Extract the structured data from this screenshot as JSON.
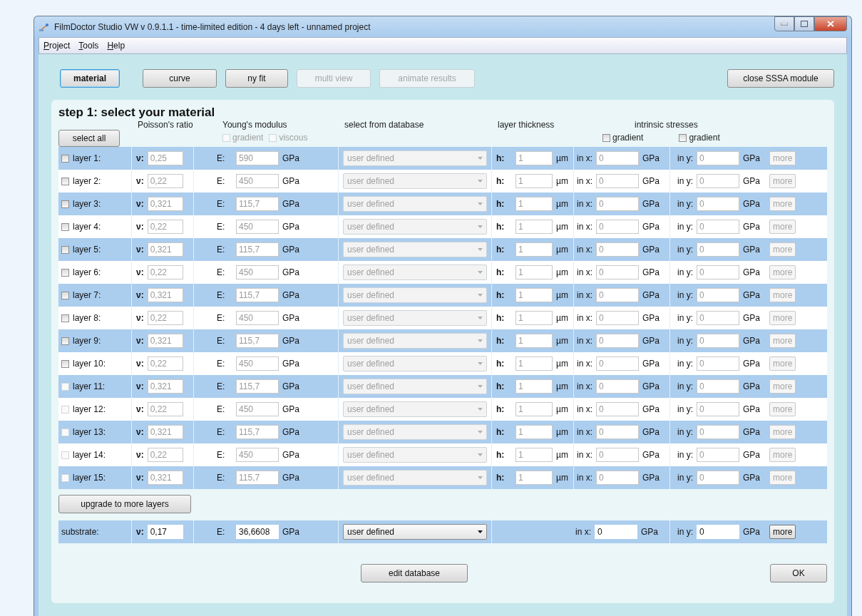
{
  "window": {
    "title": "FilmDoctor Studio VW v 0.9.1.1 - time-limited edition - 4 days left - unnamed project"
  },
  "menu": [
    {
      "label": "Project"
    },
    {
      "label": "Tools"
    },
    {
      "label": "Help"
    }
  ],
  "toolbar": [
    {
      "label": "material",
      "selected": true,
      "disabled": false
    },
    {
      "label": "curve",
      "selected": false,
      "disabled": false
    },
    {
      "label": "ny fit",
      "selected": false,
      "disabled": false
    },
    {
      "label": "multi view",
      "selected": false,
      "disabled": true
    },
    {
      "label": "animate results",
      "selected": false,
      "disabled": true
    }
  ],
  "close_button": "close SSSA module",
  "step_title": "step 1: select your material",
  "select_all": "select all",
  "headers": {
    "poisson": "Poisson's ratio",
    "young": "Young's modulus",
    "database": "select from database",
    "thickness": "layer thickness",
    "stresses": "intrinsic stresses"
  },
  "young_options": [
    {
      "label": "gradient",
      "checked": false,
      "disabled": true
    },
    {
      "label": "viscous",
      "checked": false,
      "disabled": true
    }
  ],
  "stress_options": [
    {
      "label": "gradient",
      "checked": false,
      "disabled": false
    },
    {
      "label": "gradient",
      "checked": false,
      "disabled": false
    }
  ],
  "layers": [
    {
      "label": "layer 1:",
      "checked": false,
      "checkbox_disabled": false,
      "disabled": true,
      "nu_label": "ν:",
      "nu": "0,25",
      "e_label": "E:",
      "e": "590",
      "e_unit": "GPa",
      "database": "user defined",
      "h_label": "h:",
      "h": "1",
      "h_unit": "µm",
      "sx_label": "in x:",
      "sx": "0",
      "sx_unit": "GPa",
      "sy_label": "in y:",
      "sy": "0",
      "sy_unit": "GPa",
      "more": "more"
    },
    {
      "label": "layer 2:",
      "checked": false,
      "checkbox_disabled": false,
      "disabled": true,
      "nu_label": "ν:",
      "nu": "0,22",
      "e_label": "E:",
      "e": "450",
      "e_unit": "GPa",
      "database": "user defined",
      "h_label": "h:",
      "h": "1",
      "h_unit": "µm",
      "sx_label": "in x:",
      "sx": "0",
      "sx_unit": "GPa",
      "sy_label": "in y:",
      "sy": "0",
      "sy_unit": "GPa",
      "more": "more"
    },
    {
      "label": "layer 3:",
      "checked": false,
      "checkbox_disabled": false,
      "disabled": true,
      "nu_label": "ν:",
      "nu": "0,321",
      "e_label": "E:",
      "e": "115,7",
      "e_unit": "GPa",
      "database": "user defined",
      "h_label": "h:",
      "h": "1",
      "h_unit": "µm",
      "sx_label": "in x:",
      "sx": "0",
      "sx_unit": "GPa",
      "sy_label": "in y:",
      "sy": "0",
      "sy_unit": "GPa",
      "more": "more"
    },
    {
      "label": "layer 4:",
      "checked": false,
      "checkbox_disabled": false,
      "disabled": true,
      "nu_label": "ν:",
      "nu": "0,22",
      "e_label": "E:",
      "e": "450",
      "e_unit": "GPa",
      "database": "user defined",
      "h_label": "h:",
      "h": "1",
      "h_unit": "µm",
      "sx_label": "in x:",
      "sx": "0",
      "sx_unit": "GPa",
      "sy_label": "in y:",
      "sy": "0",
      "sy_unit": "GPa",
      "more": "more"
    },
    {
      "label": "layer 5:",
      "checked": false,
      "checkbox_disabled": false,
      "disabled": true,
      "nu_label": "ν:",
      "nu": "0,321",
      "e_label": "E:",
      "e": "115,7",
      "e_unit": "GPa",
      "database": "user defined",
      "h_label": "h:",
      "h": "1",
      "h_unit": "µm",
      "sx_label": "in x:",
      "sx": "0",
      "sx_unit": "GPa",
      "sy_label": "in y:",
      "sy": "0",
      "sy_unit": "GPa",
      "more": "more"
    },
    {
      "label": "layer 6:",
      "checked": false,
      "checkbox_disabled": false,
      "disabled": true,
      "nu_label": "ν:",
      "nu": "0,22",
      "e_label": "E:",
      "e": "450",
      "e_unit": "GPa",
      "database": "user defined",
      "h_label": "h:",
      "h": "1",
      "h_unit": "µm",
      "sx_label": "in x:",
      "sx": "0",
      "sx_unit": "GPa",
      "sy_label": "in y:",
      "sy": "0",
      "sy_unit": "GPa",
      "more": "more"
    },
    {
      "label": "layer 7:",
      "checked": false,
      "checkbox_disabled": false,
      "disabled": true,
      "nu_label": "ν:",
      "nu": "0,321",
      "e_label": "E:",
      "e": "115,7",
      "e_unit": "GPa",
      "database": "user defined",
      "h_label": "h:",
      "h": "1",
      "h_unit": "µm",
      "sx_label": "in x:",
      "sx": "0",
      "sx_unit": "GPa",
      "sy_label": "in y:",
      "sy": "0",
      "sy_unit": "GPa",
      "more": "more"
    },
    {
      "label": "layer 8:",
      "checked": false,
      "checkbox_disabled": false,
      "disabled": true,
      "nu_label": "ν:",
      "nu": "0,22",
      "e_label": "E:",
      "e": "450",
      "e_unit": "GPa",
      "database": "user defined",
      "h_label": "h:",
      "h": "1",
      "h_unit": "µm",
      "sx_label": "in x:",
      "sx": "0",
      "sx_unit": "GPa",
      "sy_label": "in y:",
      "sy": "0",
      "sy_unit": "GPa",
      "more": "more"
    },
    {
      "label": "layer 9:",
      "checked": false,
      "checkbox_disabled": false,
      "disabled": true,
      "nu_label": "ν:",
      "nu": "0,321",
      "e_label": "E:",
      "e": "115,7",
      "e_unit": "GPa",
      "database": "user defined",
      "h_label": "h:",
      "h": "1",
      "h_unit": "µm",
      "sx_label": "in x:",
      "sx": "0",
      "sx_unit": "GPa",
      "sy_label": "in y:",
      "sy": "0",
      "sy_unit": "GPa",
      "more": "more"
    },
    {
      "label": "layer 10:",
      "checked": false,
      "checkbox_disabled": false,
      "disabled": true,
      "nu_label": "ν:",
      "nu": "0,22",
      "e_label": "E:",
      "e": "450",
      "e_unit": "GPa",
      "database": "user defined",
      "h_label": "h:",
      "h": "1",
      "h_unit": "µm",
      "sx_label": "in x:",
      "sx": "0",
      "sx_unit": "GPa",
      "sy_label": "in y:",
      "sy": "0",
      "sy_unit": "GPa",
      "more": "more"
    },
    {
      "label": "layer 11:",
      "checked": false,
      "checkbox_disabled": true,
      "disabled": true,
      "nu_label": "ν:",
      "nu": "0,321",
      "e_label": "E:",
      "e": "115,7",
      "e_unit": "GPa",
      "database": "user defined",
      "h_label": "h:",
      "h": "1",
      "h_unit": "µm",
      "sx_label": "in x:",
      "sx": "0",
      "sx_unit": "GPa",
      "sy_label": "in y:",
      "sy": "0",
      "sy_unit": "GPa",
      "more": "more"
    },
    {
      "label": "layer 12:",
      "checked": false,
      "checkbox_disabled": true,
      "disabled": true,
      "nu_label": "ν:",
      "nu": "0,22",
      "e_label": "E:",
      "e": "450",
      "e_unit": "GPa",
      "database": "user defined",
      "h_label": "h:",
      "h": "1",
      "h_unit": "µm",
      "sx_label": "in x:",
      "sx": "0",
      "sx_unit": "GPa",
      "sy_label": "in y:",
      "sy": "0",
      "sy_unit": "GPa",
      "more": "more"
    },
    {
      "label": "layer 13:",
      "checked": false,
      "checkbox_disabled": true,
      "disabled": true,
      "nu_label": "ν:",
      "nu": "0,321",
      "e_label": "E:",
      "e": "115,7",
      "e_unit": "GPa",
      "database": "user defined",
      "h_label": "h:",
      "h": "1",
      "h_unit": "µm",
      "sx_label": "in x:",
      "sx": "0",
      "sx_unit": "GPa",
      "sy_label": "in y:",
      "sy": "0",
      "sy_unit": "GPa",
      "more": "more"
    },
    {
      "label": "layer 14:",
      "checked": false,
      "checkbox_disabled": true,
      "disabled": true,
      "nu_label": "ν:",
      "nu": "0,22",
      "e_label": "E:",
      "e": "450",
      "e_unit": "GPa",
      "database": "user defined",
      "h_label": "h:",
      "h": "1",
      "h_unit": "µm",
      "sx_label": "in x:",
      "sx": "0",
      "sx_unit": "GPa",
      "sy_label": "in y:",
      "sy": "0",
      "sy_unit": "GPa",
      "more": "more"
    },
    {
      "label": "layer 15:",
      "checked": false,
      "checkbox_disabled": true,
      "disabled": true,
      "nu_label": "ν:",
      "nu": "0,321",
      "e_label": "E:",
      "e": "115,7",
      "e_unit": "GPa",
      "database": "user defined",
      "h_label": "h:",
      "h": "1",
      "h_unit": "µm",
      "sx_label": "in x:",
      "sx": "0",
      "sx_unit": "GPa",
      "sy_label": "in y:",
      "sy": "0",
      "sy_unit": "GPa",
      "more": "more"
    }
  ],
  "upgrade_button": "upgrade to more layers",
  "substrate": {
    "label": "substrate:",
    "disabled": false,
    "nu_label": "ν:",
    "nu": "0,17",
    "e_label": "E:",
    "e": "36,6608",
    "e_unit": "GPa",
    "database": "user defined",
    "sx_label": "in x:",
    "sx": "0",
    "sx_unit": "GPa",
    "sy_label": "in y:",
    "sy": "0",
    "sy_unit": "GPa",
    "more": "more"
  },
  "edit_database": "edit database",
  "ok": "OK"
}
